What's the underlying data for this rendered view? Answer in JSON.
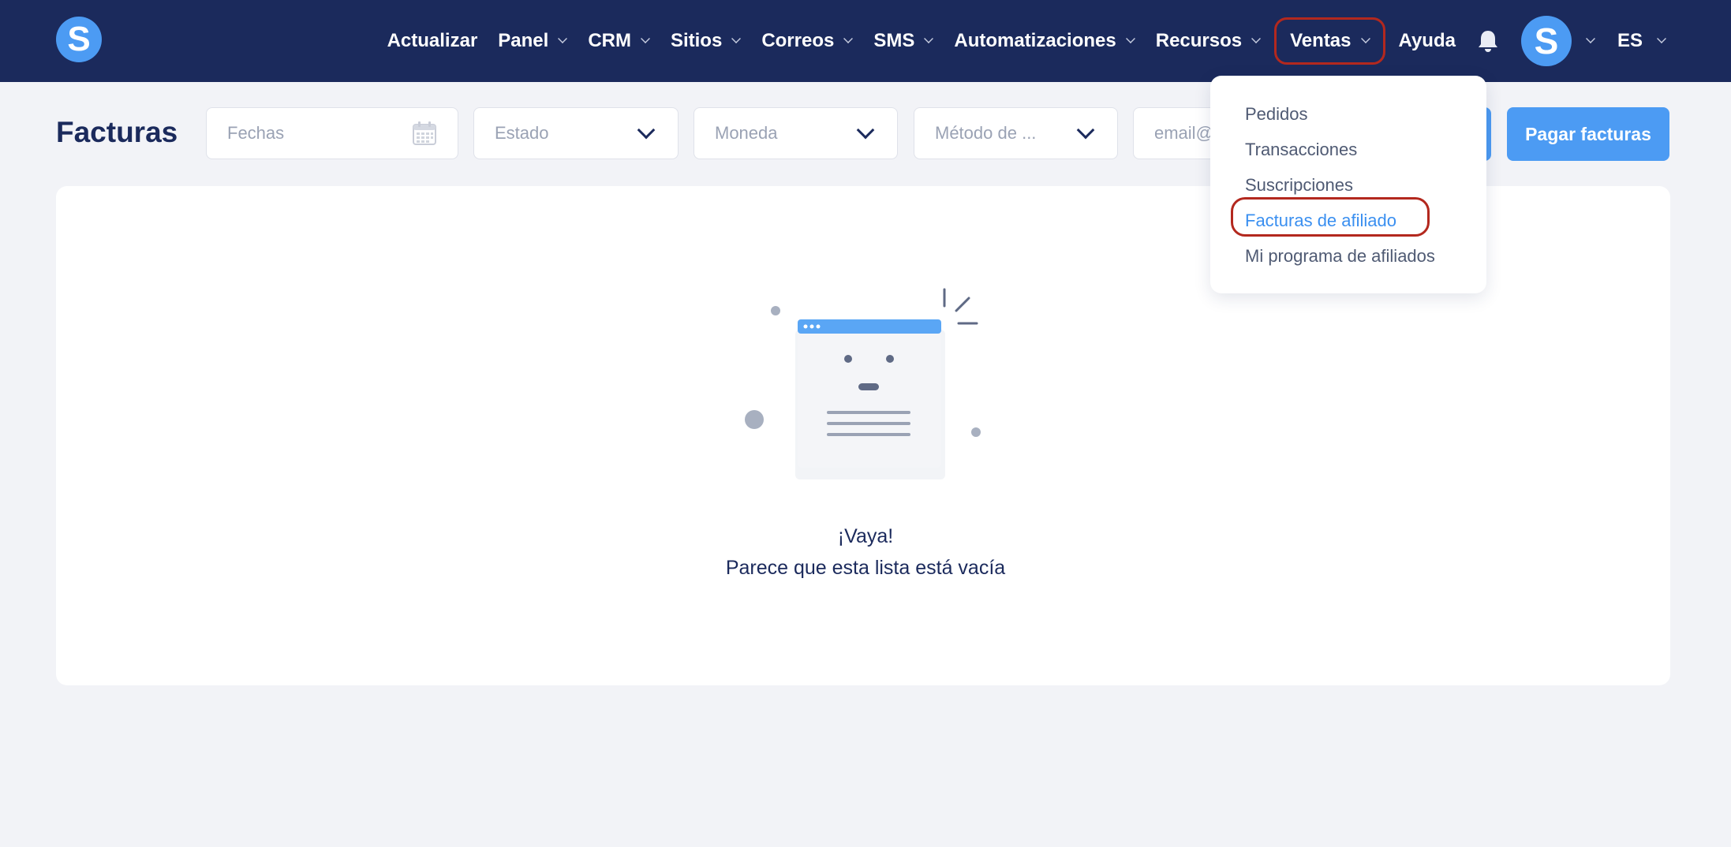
{
  "app": {
    "logo_letter": "S"
  },
  "nav": {
    "items": [
      {
        "label": "Actualizar",
        "has_chevron": false
      },
      {
        "label": "Panel",
        "has_chevron": true
      },
      {
        "label": "CRM",
        "has_chevron": true
      },
      {
        "label": "Sitios",
        "has_chevron": true
      },
      {
        "label": "Correos",
        "has_chevron": true
      },
      {
        "label": "SMS",
        "has_chevron": true
      },
      {
        "label": "Automatizaciones",
        "has_chevron": true
      },
      {
        "label": "Recursos",
        "has_chevron": true
      },
      {
        "label": "Ventas",
        "has_chevron": true,
        "active": true
      },
      {
        "label": "Ayuda",
        "has_chevron": false
      }
    ],
    "avatar_letter": "S",
    "language": "ES"
  },
  "page": {
    "title": "Facturas"
  },
  "filters": {
    "dates_placeholder": "Fechas",
    "status_placeholder": "Estado",
    "currency_placeholder": "Moneda",
    "payment_method_placeholder": "Método de ...",
    "email_placeholder": "email@"
  },
  "actions": {
    "pay_invoices": "Pagar facturas"
  },
  "empty_state": {
    "title": "¡Vaya!",
    "message": "Parece que esta lista está vacía"
  },
  "ventas_menu": {
    "items": [
      {
        "label": "Pedidos"
      },
      {
        "label": "Transacciones"
      },
      {
        "label": "Suscripciones"
      },
      {
        "label": "Facturas de afiliado",
        "highlighted": true
      },
      {
        "label": "Mi programa de afiliados"
      }
    ]
  },
  "colors": {
    "nav_bg": "#1b2a5c",
    "accent": "#4c9bf3",
    "highlight_ring": "#b3281e",
    "page_bg": "#f2f3f7"
  },
  "icons": [
    "calendar-icon",
    "bell-icon",
    "chevron-down-icon"
  ]
}
